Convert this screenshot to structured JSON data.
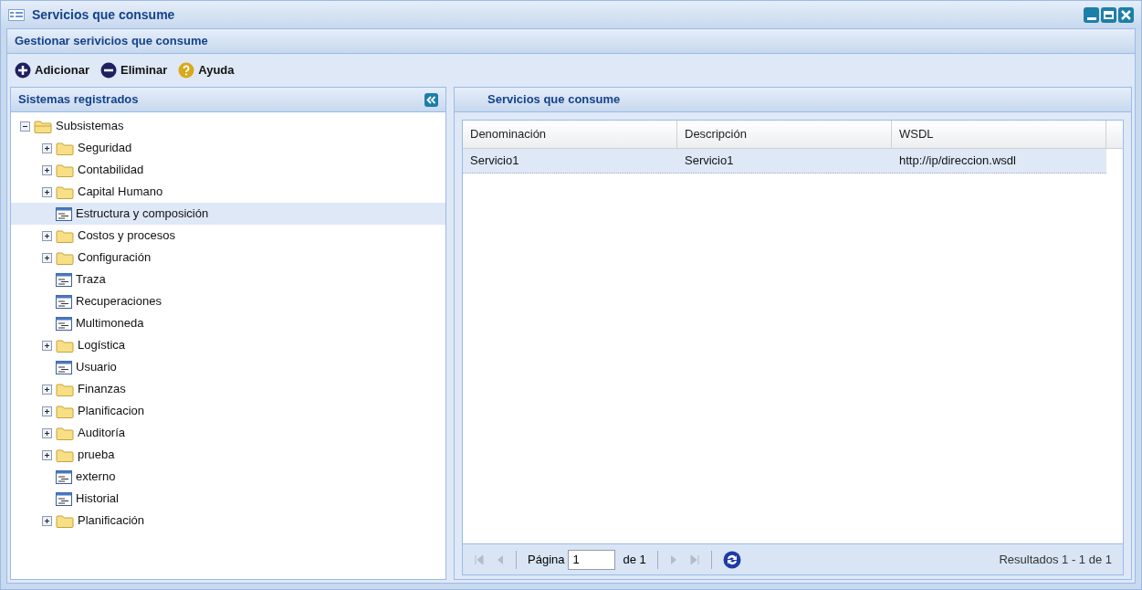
{
  "window": {
    "title": "Servicios que consume"
  },
  "section_title": "Gestionar serivicios que consume",
  "toolbar": [
    {
      "kind": "add",
      "label": "Adicionar"
    },
    {
      "kind": "remove",
      "label": "Eliminar"
    },
    {
      "kind": "help",
      "label": "Ayuda"
    }
  ],
  "left_panel": {
    "title": "Sistemas registrados",
    "tree": [
      {
        "label": "Subsistemas",
        "kind": "folder",
        "expanded": true,
        "selected": false,
        "children": [
          {
            "label": "Seguridad",
            "kind": "folder",
            "expanded": false,
            "selected": false
          },
          {
            "label": "Contabilidad",
            "kind": "folder",
            "expanded": false,
            "selected": false
          },
          {
            "label": "Capital Humano",
            "kind": "folder",
            "expanded": false,
            "selected": false
          },
          {
            "label": "Estructura y composición",
            "kind": "leaf",
            "selected": true
          },
          {
            "label": "Costos y procesos",
            "kind": "folder",
            "expanded": false,
            "selected": false
          },
          {
            "label": "Configuración",
            "kind": "folder",
            "expanded": false,
            "selected": false
          },
          {
            "label": "Traza",
            "kind": "leaf",
            "selected": false
          },
          {
            "label": "Recuperaciones",
            "kind": "leaf",
            "selected": false
          },
          {
            "label": "Multimoneda",
            "kind": "leaf",
            "selected": false
          },
          {
            "label": "Logística",
            "kind": "folder",
            "expanded": false,
            "selected": false
          },
          {
            "label": "Usuario",
            "kind": "leaf",
            "selected": false
          },
          {
            "label": "Finanzas",
            "kind": "folder",
            "expanded": false,
            "selected": false
          },
          {
            "label": "Planificacion",
            "kind": "folder",
            "expanded": false,
            "selected": false
          },
          {
            "label": "Auditoría",
            "kind": "folder",
            "expanded": false,
            "selected": false
          },
          {
            "label": "prueba",
            "kind": "folder",
            "expanded": false,
            "selected": false
          },
          {
            "label": "externo",
            "kind": "leaf",
            "selected": false
          },
          {
            "label": "Historial",
            "kind": "leaf",
            "selected": false
          },
          {
            "label": "Planificación",
            "kind": "folder",
            "expanded": false,
            "selected": false
          }
        ]
      }
    ]
  },
  "right_panel": {
    "title": "Servicios que consume",
    "table": {
      "columns": [
        "Denominación",
        "Descripción",
        "WSDL"
      ],
      "rows": [
        {
          "cells": [
            "Servicio1",
            "Servicio1",
            "http://ip/direccion.wsdl"
          ],
          "selected": true
        }
      ]
    },
    "pager": {
      "page_label": "Página",
      "page": "1",
      "of": "de 1",
      "results": "Resultados 1 - 1 de 1"
    }
  }
}
